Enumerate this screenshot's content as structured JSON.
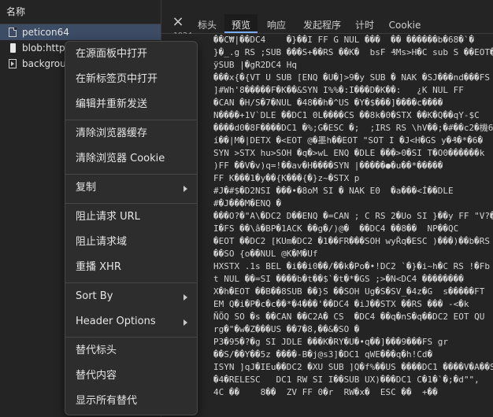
{
  "request_list": {
    "column_header": "名称",
    "rows": [
      {
        "name": "peticon64",
        "icon": "document-icon",
        "selected": true
      },
      {
        "name": "blob:http",
        "icon": "blob-icon",
        "selected": false
      },
      {
        "name": "backgrou",
        "icon": "media-icon",
        "selected": false
      }
    ]
  },
  "tabs": {
    "close": "×",
    "items": [
      {
        "label": "标头",
        "active": false
      },
      {
        "label": "预览",
        "active": true
      },
      {
        "label": "响应",
        "active": false
      },
      {
        "label": "发起程序",
        "active": false
      },
      {
        "label": "计时",
        "active": false
      },
      {
        "label": "Cookie",
        "active": false
      }
    ]
  },
  "preview": {
    "top_fragment": "1924",
    "lines": [
      "��C₩|��DC4    �}��I FF G NUL ���  �� ������b�68�`�",
      "}�_.g RS ;SUB ���S+��RS ��K�  bsF ₰Ms>H�C sub S ��EOT�n�",
      "ÿSUB |�gR2DC4 Hq",
      "���x{�{VT U SUB [ENQ �U�]>9�y SUB � NAK �SJ���nd���FS",
      "]#Wh'8�����F�K��&SYN I%%�:I���D�K��:   ¿K NUL FF",
      "�CAN �H/S�7�NUL �48��h�^US �Y�$���]����c����",
      "N����+1V`DLE ��DC1 0L����CS ��8k�0�STX ��K�Q��qY-$C",
      "����d0�8F����DC1 �%;G�ESC �;  ;IRS RS \\hV��;�#��c2�機6A",
      "í��|M�|DETX �<EOT @�墨h��EOT \"SOT I �J<H�GS y�₰�*�6�",
      "SYN >STX hu>SOH �q�>wL ENQ �DLE ���>0�SI T�O0������k",
      ")FF ��V�v)q=!��av�H����SYN |�����●�u��*�����",
      "FF K���1�y��{K���{�}z~�STX p",
      "#J�#$�D2NSI ���•�8oM SI � NAK E0 ￼�a���<Í��DLE",
      "#�J���M�ENQ �",
      "���O?�\"A\\�DC2 D��ENQ �=CAN ; C RS 2�Uo SI }��y FF \"V?�",
      "I�FS ��\\â�BP�1ACK ��g�/)@�  ��DC4 ��8��  NP��QC",
      "�EOT ��DC2 [KUm�DC2 �1��FR���SOH wyŘq�ESC )���)��b�RS",
      "��SO {o��NUL @K�M�Uf",
      "HXSTX .1s BEL �i��i0��/��k�Po�•!DC2 `�}�i~h�C RS !�Fb",
      "t NUL ��=SI ����b�t��$`�t�*�GS ;>�N<DC4 ��������",
      "X�h�EOT ��B��8SUB ��}S ��SOH Ug�S�SV_�4z�G  s�����FT",
      "EM Q�i�P�c�c��*�4���'��DC4 �iJ��STX ��RS ��� -<�k",
      "ÑÕQ SO �s ��CAN ��C2A� CS  �DC4 ��q�nS�q��DC2 EOT QU",
      "rg�\"�w�Z���US ��7�8,��&�SO �",
      "P3�95�?�g SI JDLE ���K�RY�U�•q��]���9���FS gr",
      "��S/��Y��5z ����-B�j@s3]�DC1 qWE���q�h!Cd�",
      "ISYN ]qJ�IEu��DC2 �XU SUB ]Q�f%��US ����DC1 ����V�A��SOH",
      "�4�RELESC   DC1 RW SI I��SUB UX)���DC1 C�1�`�;�d\"\",",
      "4C ��    8��  ZV FF 0�r  RW�x�  ESC ��  +��"
    ]
  },
  "context_menu": {
    "items": [
      {
        "label": "在源面板中打开",
        "submenu": false
      },
      {
        "label": "在新标签页中打开",
        "submenu": false
      },
      {
        "label": "编辑并重新发送",
        "submenu": false
      },
      {
        "label": "清除浏览器缓存",
        "submenu": false
      },
      {
        "label": "清除浏览器 Cookie",
        "submenu": false
      },
      {
        "label": "复制",
        "submenu": true
      },
      {
        "label": "阻止请求 URL",
        "submenu": false
      },
      {
        "label": "阻止请求域",
        "submenu": false
      },
      {
        "label": "重播 XHR",
        "submenu": false
      },
      {
        "label": "Sort By",
        "submenu": true
      },
      {
        "label": "Header Options",
        "submenu": true
      },
      {
        "label": "替代标头",
        "submenu": false
      },
      {
        "label": "替代内容",
        "submenu": false
      },
      {
        "label": "显示所有替代",
        "submenu": false
      }
    ]
  },
  "colors": {
    "background": "#242424",
    "menu_background": "#2d2d2d",
    "selected_row": "#3c4c64",
    "active_tab_underline": "#7cacf8"
  }
}
